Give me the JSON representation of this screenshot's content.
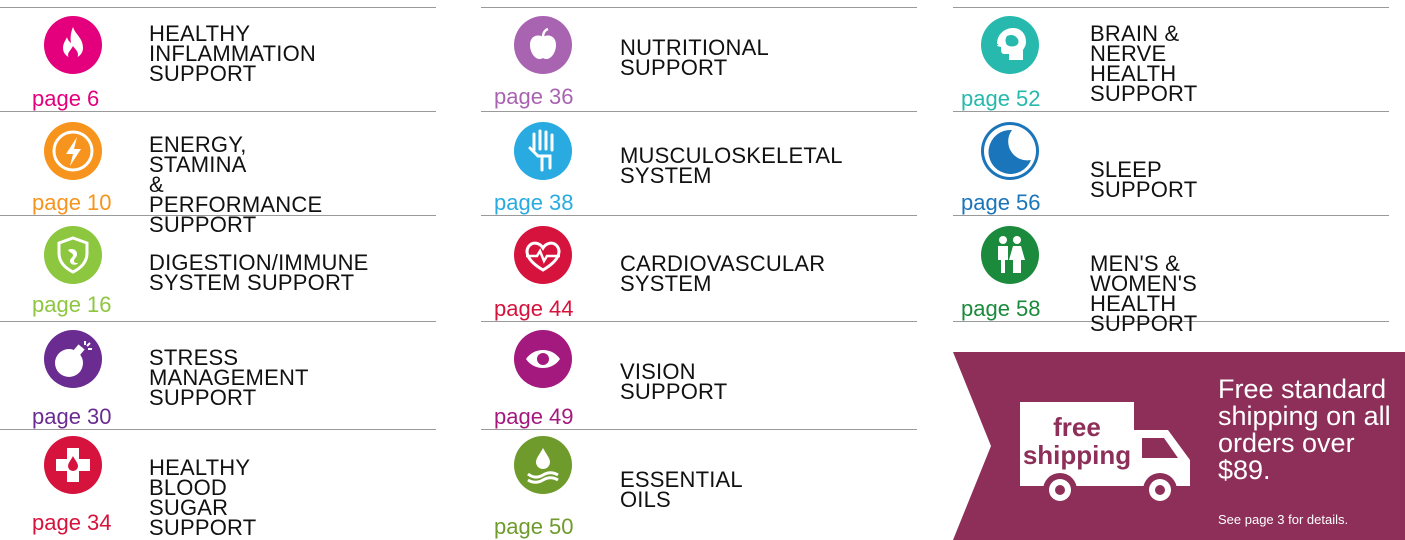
{
  "colors": {
    "rule": "#9a9a9a",
    "promo_bg": "#8d2f58"
  },
  "items": [
    {
      "page": "page 6",
      "label": "HEALTHY\nINFLAMMATION\nSUPPORT",
      "color": "#e4007c",
      "icon": "flame-icon"
    },
    {
      "page": "page 10",
      "label": "ENERGY, STAMINA\n& PERFORMANCE\nSUPPORT",
      "color": "#f7941d",
      "icon": "lightning-icon"
    },
    {
      "page": "page 16",
      "label": "DIGESTION/IMMUNE\nSYSTEM SUPPORT",
      "color": "#8dc63f",
      "icon": "shield-icon"
    },
    {
      "page": "page 30",
      "label": "STRESS\nMANAGEMENT\nSUPPORT",
      "color": "#6a2c91",
      "icon": "bomb-icon"
    },
    {
      "page": "page 34",
      "label": "HEALTHY\nBLOOD SUGAR\nSUPPORT",
      "color": "#d6133d",
      "icon": "medical-cross-icon"
    },
    {
      "page": "page 36",
      "label": "NUTRITIONAL\nSUPPORT",
      "color": "#a864b0",
      "icon": "apple-icon"
    },
    {
      "page": "page 38",
      "label": "MUSCULOSKELETAL\nSYSTEM",
      "color": "#29abe2",
      "icon": "hand-skeleton-icon"
    },
    {
      "page": "page 44",
      "label": "CARDIOVASCULAR\nSYSTEM",
      "color": "#d6133d",
      "icon": "heart-pulse-icon"
    },
    {
      "page": "page 49",
      "label": "VISION\nSUPPORT",
      "color": "#a3197e",
      "icon": "eye-icon"
    },
    {
      "page": "page 50",
      "label": "ESSENTIAL\nOILS",
      "color": "#6f9b2c",
      "icon": "oil-drop-icon"
    },
    {
      "page": "page 52",
      "label": "BRAIN & NERVE\nHEALTH\nSUPPORT",
      "color": "#27b9ad",
      "icon": "brain-icon"
    },
    {
      "page": "page 56",
      "label": "SLEEP SUPPORT",
      "color": "#1a75bb",
      "icon": "moon-icon"
    },
    {
      "page": "page 58",
      "label": "MEN'S & WOMEN'S\nHEALTH SUPPORT",
      "color": "#1b8a3c",
      "icon": "man-woman-icon"
    }
  ],
  "promo": {
    "badge_line1": "free",
    "badge_line2": "shipping",
    "headline": "Free standard shipping on all orders over $89.",
    "note": "See page 3 for details."
  }
}
